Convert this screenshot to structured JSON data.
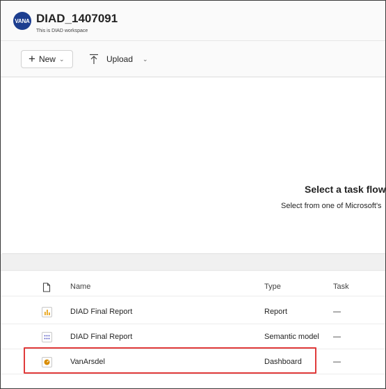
{
  "workspace": {
    "logo_text": "VANA",
    "title": "DIAD_1407091",
    "description": "This is DIAD workspace"
  },
  "toolbar": {
    "new_label": "New",
    "upload_label": "Upload"
  },
  "taskflow": {
    "title": "Select a task flow",
    "subtitle": "Select from one of Microsoft's"
  },
  "table": {
    "columns": {
      "name": "Name",
      "type": "Type",
      "task": "Task"
    },
    "rows": [
      {
        "name": "DIAD Final Report",
        "type": "Report",
        "task": "—",
        "icon": "report-icon"
      },
      {
        "name": "DIAD Final Report",
        "type": "Semantic model",
        "task": "—",
        "icon": "semantic-model-icon"
      },
      {
        "name": "VanArsdel",
        "type": "Dashboard",
        "task": "—",
        "icon": "dashboard-icon"
      }
    ]
  },
  "colors": {
    "logo_bg": "#1d3e8f",
    "highlight": "#e03a3a",
    "report_icon": "#e8a317",
    "semantic_icon": "#5b5fc7",
    "dashboard_icon": "#d98c00"
  }
}
